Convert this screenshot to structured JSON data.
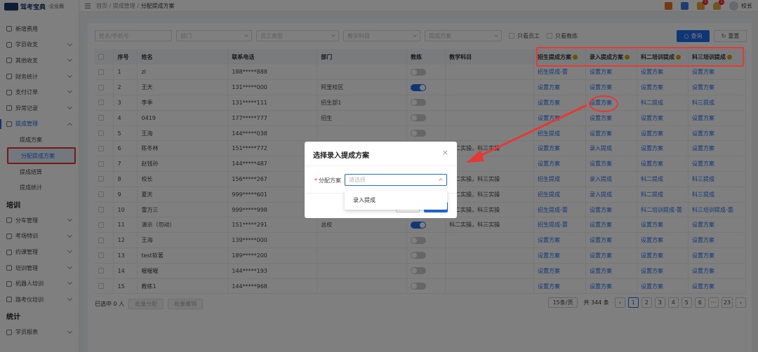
{
  "app": {
    "logo_text": "驾考宝典",
    "logo_sub": "·企业版"
  },
  "sidebar": {
    "items_top": [
      {
        "label": "新增费用",
        "chev": false
      },
      {
        "label": "学员收支",
        "chev": true
      },
      {
        "label": "其他收支",
        "chev": true
      },
      {
        "label": "财务统计",
        "chev": true
      },
      {
        "label": "支付订单",
        "chev": true
      },
      {
        "label": "异常记录",
        "chev": true
      },
      {
        "label": "提成管理",
        "chev": true,
        "active": true
      }
    ],
    "sub_items": [
      "提成方案",
      "分配提成方案",
      "提成结算",
      "提成统计"
    ],
    "selected_sub": 1,
    "section_training": "培训",
    "items_training": [
      "分车管理",
      "考场特训",
      "约课管理",
      "培训管理",
      "机器人培训",
      "路考仪培训"
    ],
    "section_stats": "统计",
    "items_stats": [
      "学员报表"
    ]
  },
  "topbar": {
    "breadcrumb_prefix": "首页 / 提成管理 / ",
    "breadcrumb_current": "分配提成方案",
    "user_name": "校长",
    "badges": [
      "1",
      "1"
    ]
  },
  "filters": {
    "name_phone_placeholder": "姓名/手机号",
    "dept_placeholder": "部门",
    "staff_type_placeholder": "员工类型",
    "subject_placeholder": "教学科目",
    "plan_placeholder": "提成方案",
    "only_staff_label": "只看员工",
    "only_coach_label": "只看教练",
    "search_label": "查询",
    "reset_label": "重置"
  },
  "table": {
    "headers": [
      "序号",
      "姓名",
      "联系电话",
      "部门",
      "教练",
      "教学科目",
      "招生提成方案",
      "录入提成方案",
      "科二培训提成",
      "科三培训提成"
    ],
    "rows": [
      [
        "1",
        "zl",
        "188*****888",
        "",
        "off",
        "",
        "招生提成-蕾",
        "设置方案",
        "设置方案",
        "设置方案"
      ],
      [
        "2",
        "王天",
        "131*****000",
        "阿里校区",
        "on",
        "",
        "设置方案",
        "设置方案",
        "设置方案",
        "设置方案"
      ],
      [
        "3",
        "李季",
        "131*****111",
        "招生部1",
        "off",
        "",
        "设置方案",
        "设置方案",
        "科二提成",
        "科三提成"
      ],
      [
        "4",
        "0419",
        "177*****777",
        "招生",
        "off",
        "",
        "设置方案",
        "设置方案",
        "设置方案",
        "设置方案"
      ],
      [
        "5",
        "王海",
        "144*****038",
        "",
        "off",
        "",
        "招生提成",
        "设置方案",
        "设置方案",
        "设置方案"
      ],
      [
        "6",
        "陈冬林",
        "151*****772",
        "",
        "off",
        "科二实操，科三实操",
        "设置方案",
        "录入提成",
        "设置方案",
        "设置方案"
      ],
      [
        "7",
        "赵钱孙",
        "144*****487",
        "",
        "off",
        "",
        "设置方案",
        "设置方案",
        "设置方案",
        "设置方案"
      ],
      [
        "8",
        "校长",
        "156*****267",
        "",
        "off",
        "科二实操，科三实操",
        "招生提成",
        "录入提成",
        "科二提成",
        "科三提成"
      ],
      [
        "9",
        "夏天",
        "999*****601",
        "",
        "off",
        "科二实操，科三实操",
        "招生提成",
        "录入提成",
        "科二提成",
        "科三提成"
      ],
      [
        "10",
        "雷万三",
        "999*****998",
        "",
        "off",
        "科二实操，科三实操",
        "招生提成-蕾",
        "设置方案",
        "科二培训提成-蕾",
        "科三培训提成-蕾"
      ],
      [
        "11",
        "演示（勿动）",
        "151*****291",
        "总校",
        "on",
        "科二实操，科三实操",
        "招生提成-蕾",
        "设置方案",
        "设置方案",
        "设置方案"
      ],
      [
        "12",
        "王海",
        "139*****000",
        "",
        "off",
        "",
        "设置方案",
        "设置方案",
        "设置方案",
        "设置方案"
      ],
      [
        "13",
        "test软著",
        "189*****200",
        "",
        "off",
        "",
        "设置方案",
        "设置方案",
        "设置方案",
        "设置方案"
      ],
      [
        "14",
        "喔喔喔",
        "144*****193",
        "",
        "off",
        "",
        "设置方案",
        "设置方案",
        "设置方案",
        "设置方案"
      ],
      [
        "15",
        "教练1",
        "144*****968",
        "",
        "off",
        "",
        "设置方案",
        "设置方案",
        "设置方案",
        "设置方案"
      ]
    ]
  },
  "footer": {
    "selected_text": "已选中 0 人",
    "batch_assign": "批量分配",
    "batch_revoke": "批量撤销",
    "page_size": "15条/页",
    "total": "共 344 条",
    "pages": [
      "1",
      "2",
      "3",
      "4",
      "5",
      "6",
      "···",
      "23"
    ],
    "current_page": "1"
  },
  "modal": {
    "title": "选择录入提成方案",
    "close": "×",
    "label": "分配方案",
    "required_mark": "*",
    "select_placeholder": "请选择",
    "option": "录入提成"
  },
  "colors": {
    "primary": "#1f6feb",
    "annotation": "#e53935"
  }
}
